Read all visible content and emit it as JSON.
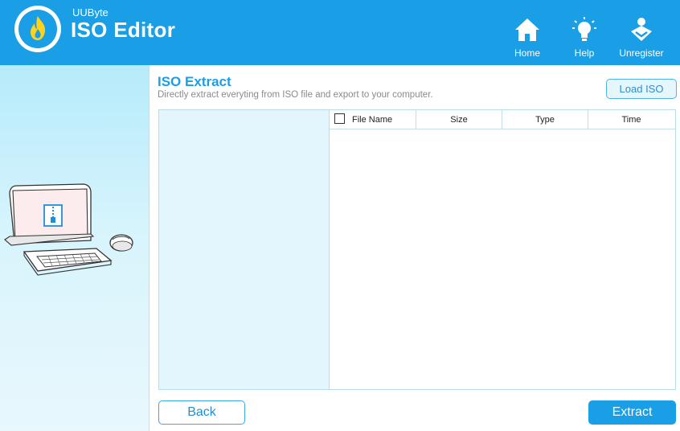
{
  "app": {
    "brand_small": "UUByte",
    "brand_big": "ISO Editor"
  },
  "nav": {
    "home": "Home",
    "help": "Help",
    "unregister": "Unregister"
  },
  "main": {
    "title": "ISO Extract",
    "subtitle": "Directly extract everyting from ISO file and export to your computer.",
    "load_button": "Load ISO",
    "columns": {
      "name": "File Name",
      "size": "Size",
      "type": "Type",
      "time": "Time"
    },
    "back_button": "Back",
    "extract_button": "Extract"
  },
  "colors": {
    "accent": "#1a9ee6",
    "panel": "#e3f6fd"
  },
  "icons": [
    "flame-logo-icon",
    "home-icon",
    "bulb-icon",
    "unregister-icon",
    "computer-illustration",
    "zip-file-icon",
    "mouse-icon"
  ]
}
